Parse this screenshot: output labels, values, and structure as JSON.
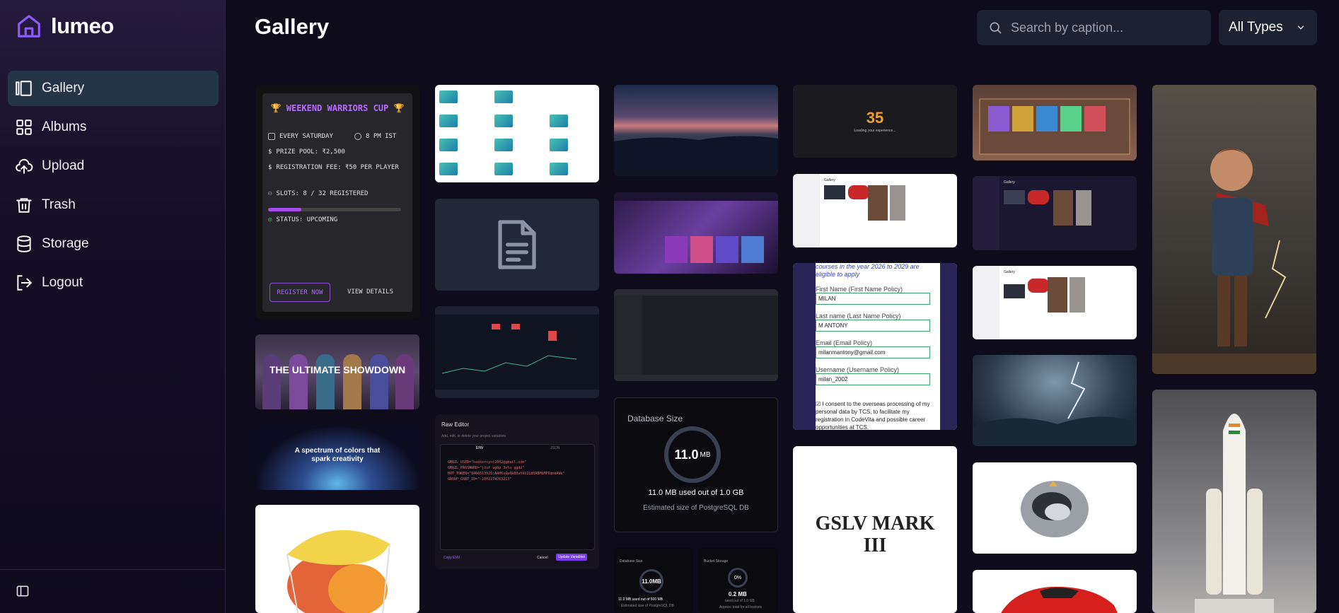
{
  "app": {
    "name": "lumeo"
  },
  "sidebar": {
    "items": [
      {
        "label": "Gallery",
        "icon": "gallery-icon",
        "active": true
      },
      {
        "label": "Albums",
        "icon": "grid-icon"
      },
      {
        "label": "Upload",
        "icon": "cloud-upload-icon"
      },
      {
        "label": "Trash",
        "icon": "trash-icon"
      },
      {
        "label": "Storage",
        "icon": "database-icon"
      },
      {
        "label": "Logout",
        "icon": "logout-icon"
      }
    ]
  },
  "header": {
    "title": "Gallery",
    "search_placeholder": "Search by caption...",
    "type_filter": "All Types"
  },
  "tiles": {
    "tournament": {
      "title": "WEEKEND WARRIORS CUP",
      "schedule": "EVERY SATURDAY",
      "time": "8 PM IST",
      "prize": "PRIZE POOL: ₹2,500",
      "fee": "REGISTRATION FEE: ₹50 PER PLAYER",
      "slots": "SLOTS: 8 / 32 REGISTERED",
      "slots_fraction": 0.25,
      "status": "STATUS: UPCOMING",
      "register": "REGISTER NOW",
      "details": "VIEW DETAILS"
    },
    "showdown": {
      "text": "THE ULTIMATE SHOWDOWN"
    },
    "spectrum": {
      "line1": "A spectrum of colors that",
      "line2": "spark creativity"
    },
    "raw_editor": {
      "title": "Raw Editor",
      "subtitle": "Add, edit, or delete your project variables",
      "tab_env": "ENV",
      "tab_json": "JSON",
      "lines": [
        "GMAIL_USER=\"hackersync2002@gmail.com\"",
        "GMAIL_PASSWORD=\"jcuf ugbp 3vlu ggdz\"",
        "BOT_TOKEN=\"8466513925:AAHKxGv0k80vhkU2Ld0ABMbMP6qmkAWe\"",
        "GROUP_CHAT_ID=\"-1002274763213\""
      ],
      "copy": "Copy ENV",
      "cancel": "Cancel",
      "update": "Update Variables"
    },
    "database": {
      "title": "Database Size",
      "value": "11.0",
      "unit": "MB",
      "used": "11.0 MB used out of 1.0 GB",
      "estimate": "Estimated size of PostgreSQL DB"
    },
    "db_mini": {
      "title": "Database Size",
      "value": "11.0MB",
      "used": "11.0 MB used out of 500 MB",
      "estimate": "Estimated size of PostgreSQL DB"
    },
    "bucket_mini": {
      "title": "Bucket Storage",
      "percent": "0%",
      "value": "0.2 MB",
      "used": "used out of 1.0 GB",
      "estimate": "Approx. total for all buckets"
    },
    "loading": {
      "number": "35",
      "text": "Loading your experience..."
    },
    "form": {
      "intro": "courses in the year 2026 to 2029 are eligible to apply",
      "first_label": "First Name (First Name Policy)",
      "first_value": "MILAN",
      "last_label": "Last name (Last Name Policy)",
      "last_value": "M ANTONY",
      "email_label": "Email (Email Policy)",
      "email_value": "milanmantony@gmail.com",
      "user_label": "Username (Username Policy)",
      "user_value": "milan_2002",
      "consent": "I consent to the overseas processing of my personal data by TCS, to facilitate my registration in CodeVita and possible career opportunities at TCS."
    },
    "gslv": {
      "line1": "GSLV MARK",
      "line2": "III"
    },
    "mini_gallery": {
      "title": "Gallery"
    }
  },
  "colors": {
    "accent": "#a54ef0",
    "active_nav": "#253548",
    "background": "#0e0b1a"
  }
}
